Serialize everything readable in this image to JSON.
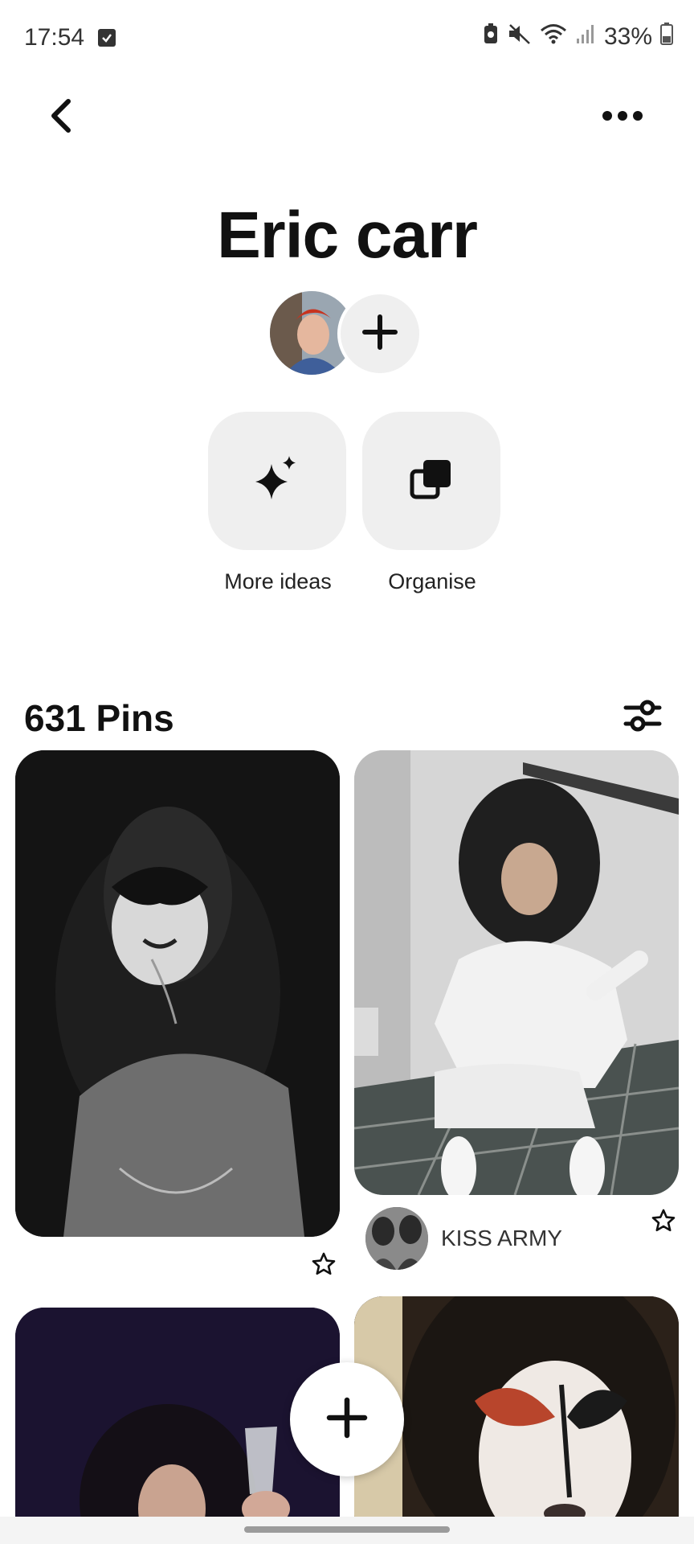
{
  "status_bar": {
    "time": "17:54",
    "battery": "33%",
    "icons": [
      "check-icon",
      "battery-saver-icon",
      "mute-icon",
      "wifi-icon",
      "signal-icon",
      "battery-icon"
    ]
  },
  "top_bar": {
    "back_icon": "chevron-left-icon",
    "more_icon": "ellipsis-icon"
  },
  "board": {
    "title": "Eric carr",
    "add_collaborator_icon": "plus-icon"
  },
  "actions": [
    {
      "label": "More ideas",
      "icon": "sparkle-icon"
    },
    {
      "label": "Organise",
      "icon": "organise-icon"
    }
  ],
  "pins_header": {
    "count": "631 Pins",
    "filter_icon": "filter-icon"
  },
  "pins": [
    {
      "id": "pin-1",
      "has_star": true
    },
    {
      "id": "pin-2",
      "has_star": true,
      "source": "KISS ARMY"
    },
    {
      "id": "pin-3"
    },
    {
      "id": "pin-4"
    }
  ],
  "fab": {
    "icon": "plus-icon"
  },
  "colors": {
    "tile_bg": "#efefef",
    "text": "#111111",
    "background": "#ffffff"
  }
}
